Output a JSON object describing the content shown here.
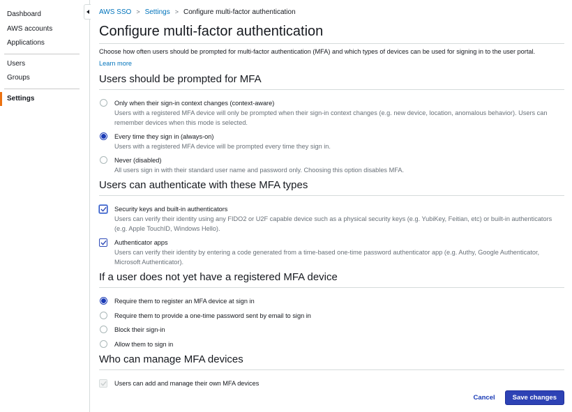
{
  "sidebar": {
    "groups": [
      {
        "items": [
          {
            "label": "Dashboard"
          },
          {
            "label": "AWS accounts"
          },
          {
            "label": "Applications"
          }
        ]
      },
      {
        "items": [
          {
            "label": "Users"
          },
          {
            "label": "Groups"
          }
        ]
      },
      {
        "items": [
          {
            "label": "Settings",
            "active": true
          }
        ]
      }
    ],
    "collapse_icon": "caret-left-icon",
    "accent_color": "#ec7211"
  },
  "breadcrumb": {
    "items": [
      {
        "label": "AWS SSO",
        "link": true
      },
      {
        "label": "Settings",
        "link": true
      },
      {
        "label": "Configure multi-factor authentication",
        "link": false
      }
    ],
    "separator": ">"
  },
  "page": {
    "title": "Configure multi-factor authentication",
    "intro": "Choose how often users should be prompted for multi-factor authentication (MFA) and which types of devices can be used for signing in to the user portal.",
    "learn_more": "Learn more"
  },
  "sections": {
    "prompt": {
      "title": "Users should be prompted for MFA",
      "options": [
        {
          "label": "Only when their sign-in context changes (context-aware)",
          "description": "Users with a registered MFA device will only be prompted when their sign-in context changes (e.g. new device, location, anomalous behavior). Users can remember devices when this mode is selected.",
          "selected": false
        },
        {
          "label": "Every time they sign in (always-on)",
          "description": "Users with a registered MFA device will be prompted every time they sign in.",
          "selected": true
        },
        {
          "label": "Never (disabled)",
          "description": "All users sign in with their standard user name and password only. Choosing this option disables MFA.",
          "selected": false
        }
      ]
    },
    "types": {
      "title": "Users can authenticate with these MFA types",
      "options": [
        {
          "label": "Security keys and built-in authenticators",
          "description": "Users can verify their identity using any FIDO2 or U2F capable device such as a physical security keys (e.g. YubiKey, Feitian, etc) or built-in authenticators (e.g. Apple TouchID, Windows Hello).",
          "checked": true
        },
        {
          "label": "Authenticator apps",
          "description": "Users can verify their identity by entering a code generated from a time-based one-time password authenticator app (e.g. Authy, Google Authenticator, Microsoft Authenticator).",
          "checked": true
        }
      ]
    },
    "no_device": {
      "title": "If a user does not yet have a registered MFA device",
      "options": [
        {
          "label": "Require them to register an MFA device at sign in",
          "selected": true
        },
        {
          "label": "Require them to provide a one-time password sent by email to sign in",
          "selected": false
        },
        {
          "label": "Block their sign-in",
          "selected": false
        },
        {
          "label": "Allow them to sign in",
          "selected": false
        }
      ]
    },
    "manage": {
      "title": "Who can manage MFA devices",
      "options": [
        {
          "label": "Users can add and manage their own MFA devices",
          "checked": true,
          "disabled": true
        }
      ]
    }
  },
  "actions": {
    "cancel": "Cancel",
    "save": "Save changes",
    "primary_color": "#2d42b5"
  }
}
